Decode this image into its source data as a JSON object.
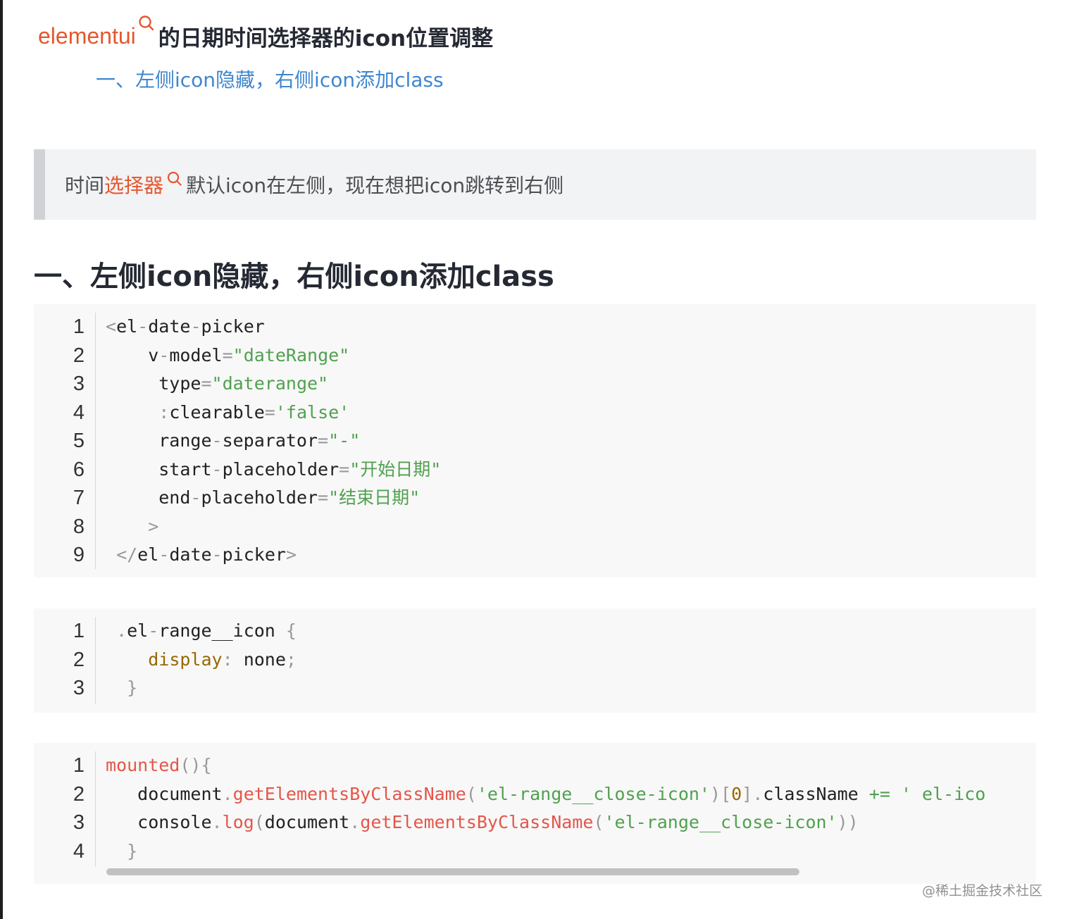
{
  "article": {
    "title_keyword": "elementui",
    "title_rest": "的日期时间选择器的icon位置调整",
    "toc_link": "一、左侧icon隐藏，右侧icon添加class",
    "quote_prefix": "时间 ",
    "quote_keyword": "选择器",
    "quote_suffix": "默认icon在左侧，现在想把icon跳转到右侧",
    "heading": "一、左侧icon隐藏，右侧icon添加class"
  },
  "code_blocks": [
    {
      "line_numbers": [
        "1",
        "2",
        "3",
        "4",
        "5",
        "6",
        "7",
        "8",
        "9"
      ],
      "lines": [
        [
          {
            "t": "<",
            "c": "punc"
          },
          {
            "t": "el",
            "c": "tag"
          },
          {
            "t": "-",
            "c": "punc"
          },
          {
            "t": "date",
            "c": "tag"
          },
          {
            "t": "-",
            "c": "punc"
          },
          {
            "t": "picker",
            "c": "tag"
          }
        ],
        [
          {
            "t": "    v",
            "c": "plain"
          },
          {
            "t": "-",
            "c": "punc"
          },
          {
            "t": "model",
            "c": "plain"
          },
          {
            "t": "=",
            "c": "punc"
          },
          {
            "t": "\"dateRange\"",
            "c": "str"
          }
        ],
        [
          {
            "t": "     type",
            "c": "plain"
          },
          {
            "t": "=",
            "c": "punc"
          },
          {
            "t": "\"daterange\"",
            "c": "str"
          }
        ],
        [
          {
            "t": "     ",
            "c": "plain"
          },
          {
            "t": ":",
            "c": "punc"
          },
          {
            "t": "clearable",
            "c": "plain"
          },
          {
            "t": "=",
            "c": "punc"
          },
          {
            "t": "'false'",
            "c": "str"
          }
        ],
        [
          {
            "t": "     range",
            "c": "plain"
          },
          {
            "t": "-",
            "c": "punc"
          },
          {
            "t": "separator",
            "c": "plain"
          },
          {
            "t": "=",
            "c": "punc"
          },
          {
            "t": "\"-\"",
            "c": "str"
          }
        ],
        [
          {
            "t": "     start",
            "c": "plain"
          },
          {
            "t": "-",
            "c": "punc"
          },
          {
            "t": "placeholder",
            "c": "plain"
          },
          {
            "t": "=",
            "c": "punc"
          },
          {
            "t": "\"开始日期\"",
            "c": "str"
          }
        ],
        [
          {
            "t": "     end",
            "c": "plain"
          },
          {
            "t": "-",
            "c": "punc"
          },
          {
            "t": "placeholder",
            "c": "plain"
          },
          {
            "t": "=",
            "c": "punc"
          },
          {
            "t": "\"结束日期\"",
            "c": "str"
          }
        ],
        [
          {
            "t": "    ",
            "c": "plain"
          },
          {
            "t": ">",
            "c": "punc"
          }
        ],
        [
          {
            "t": " ",
            "c": "plain"
          },
          {
            "t": "</",
            "c": "punc"
          },
          {
            "t": "el",
            "c": "tag"
          },
          {
            "t": "-",
            "c": "punc"
          },
          {
            "t": "date",
            "c": "tag"
          },
          {
            "t": "-",
            "c": "punc"
          },
          {
            "t": "picker",
            "c": "tag"
          },
          {
            "t": ">",
            "c": "punc"
          }
        ]
      ]
    },
    {
      "line_numbers": [
        "1",
        "2",
        "3"
      ],
      "lines": [
        [
          {
            "t": " ",
            "c": "plain"
          },
          {
            "t": ".",
            "c": "punc"
          },
          {
            "t": "el",
            "c": "plain"
          },
          {
            "t": "-",
            "c": "punc"
          },
          {
            "t": "range__icon ",
            "c": "plain"
          },
          {
            "t": "{",
            "c": "punc"
          }
        ],
        [
          {
            "t": "    ",
            "c": "plain"
          },
          {
            "t": "display",
            "c": "prop"
          },
          {
            "t": ":",
            "c": "punc"
          },
          {
            "t": " none",
            "c": "plain"
          },
          {
            "t": ";",
            "c": "punc"
          }
        ],
        [
          {
            "t": "  ",
            "c": "plain"
          },
          {
            "t": "}",
            "c": "punc"
          }
        ]
      ]
    },
    {
      "line_numbers": [
        "1",
        "2",
        "3",
        "4"
      ],
      "lines": [
        [
          {
            "t": "mounted",
            "c": "fn"
          },
          {
            "t": "(){",
            "c": "punc"
          }
        ],
        [
          {
            "t": "   document",
            "c": "plain"
          },
          {
            "t": ".",
            "c": "punc"
          },
          {
            "t": "getElementsByClassName",
            "c": "fn"
          },
          {
            "t": "(",
            "c": "punc"
          },
          {
            "t": "'el-range__close-icon'",
            "c": "str"
          },
          {
            "t": ")[",
            "c": "punc"
          },
          {
            "t": "0",
            "c": "prop"
          },
          {
            "t": "].",
            "c": "punc"
          },
          {
            "t": "className ",
            "c": "plain"
          },
          {
            "t": "+=",
            "c": "str"
          },
          {
            "t": " ' el-ico",
            "c": "str"
          }
        ],
        [
          {
            "t": "   console",
            "c": "plain"
          },
          {
            "t": ".",
            "c": "punc"
          },
          {
            "t": "log",
            "c": "fn"
          },
          {
            "t": "(",
            "c": "punc"
          },
          {
            "t": "document",
            "c": "plain"
          },
          {
            "t": ".",
            "c": "punc"
          },
          {
            "t": "getElementsByClassName",
            "c": "fn"
          },
          {
            "t": "(",
            "c": "punc"
          },
          {
            "t": "'el-range__close-icon'",
            "c": "str"
          },
          {
            "t": "))",
            "c": "punc"
          }
        ],
        [
          {
            "t": "  ",
            "c": "plain"
          },
          {
            "t": "}",
            "c": "punc"
          }
        ]
      ]
    }
  ],
  "watermark": "@稀土掘金技术社区",
  "colors": {
    "keyword": "#e4572e",
    "link": "#3f86cf",
    "string": "#50a14f",
    "property": "#986801",
    "function": "#e45649",
    "punctuation": "#999999"
  }
}
